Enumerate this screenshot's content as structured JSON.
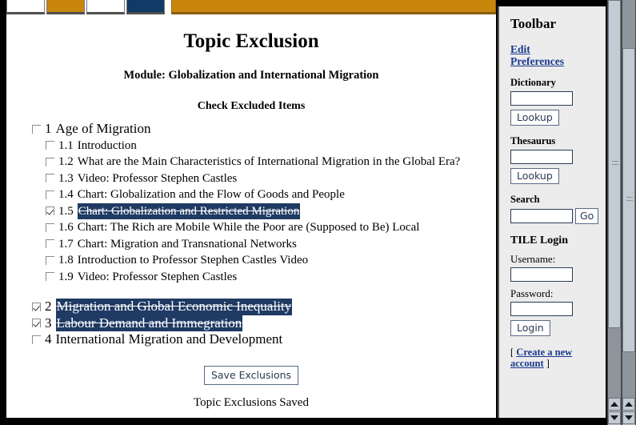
{
  "topnav": {
    "tabs": [
      {
        "name": "tab-1",
        "style": "white"
      },
      {
        "name": "tab-2",
        "style": "gold"
      },
      {
        "name": "tab-3",
        "style": "white"
      },
      {
        "name": "tab-4",
        "style": "navy"
      }
    ],
    "menu_item_count": 4
  },
  "page": {
    "title": "Topic Exclusion",
    "module_line": "Module: Globalization and International Migration",
    "section_heading": "Check Excluded Items",
    "save_button_label": "Save Exclusions",
    "status_message": "Topic Exclusions Saved"
  },
  "topics": [
    {
      "num": "1",
      "label": "Age of Migration",
      "level": 1,
      "checked": false,
      "excluded": false,
      "spaced": false
    },
    {
      "num": "1.1",
      "label": "Introduction",
      "level": 2,
      "checked": false,
      "excluded": false,
      "spaced": false
    },
    {
      "num": "1.2",
      "label": "What are the Main Characteristics of International Migration in the Global Era?",
      "level": 2,
      "checked": false,
      "excluded": false,
      "spaced": false
    },
    {
      "num": "1.3",
      "label": "Video: Professor Stephen Castles",
      "level": 2,
      "checked": false,
      "excluded": false,
      "spaced": false
    },
    {
      "num": "1.4",
      "label": "Chart: Globalization and the Flow of Goods and People",
      "level": 2,
      "checked": false,
      "excluded": false,
      "spaced": false
    },
    {
      "num": "1.5",
      "label": "Chart: Globalization and Restricted Migration",
      "level": 2,
      "checked": true,
      "excluded": true,
      "spaced": false
    },
    {
      "num": "1.6",
      "label": "Chart: The Rich are Mobile While the Poor are (Supposed to Be) Local",
      "level": 2,
      "checked": false,
      "excluded": false,
      "spaced": false
    },
    {
      "num": "1.7",
      "label": "Chart: Migration and Transnational Networks",
      "level": 2,
      "checked": false,
      "excluded": false,
      "spaced": false
    },
    {
      "num": "1.8",
      "label": "Introduction to Professor Stephen Castles Video",
      "level": 2,
      "checked": false,
      "excluded": false,
      "spaced": false
    },
    {
      "num": "1.9",
      "label": "Video: Professor Stephen Castles",
      "level": 2,
      "checked": false,
      "excluded": false,
      "spaced": false
    },
    {
      "num": "2",
      "label": "Migration and Global Economic Inequality",
      "level": 1,
      "checked": true,
      "excluded": true,
      "spaced": true
    },
    {
      "num": "3",
      "label": "Labour Demand and Immegration",
      "level": 1,
      "checked": true,
      "excluded": true,
      "spaced": false
    },
    {
      "num": "4",
      "label": "International Migration and Development",
      "level": 1,
      "checked": false,
      "excluded": false,
      "spaced": false
    }
  ],
  "toolbar": {
    "title": "Toolbar",
    "edit_preferences_link": "Edit Preferences",
    "dictionary": {
      "label": "Dictionary",
      "input_value": "",
      "button_label": "Lookup"
    },
    "thesaurus": {
      "label": "Thesaurus",
      "input_value": "",
      "button_label": "Lookup"
    },
    "search": {
      "label": "Search",
      "input_value": "",
      "button_label": "Go"
    },
    "login": {
      "title": "TILE Login",
      "username_label": "Username:",
      "username_value": "",
      "password_label": "Password:",
      "password_value": "",
      "button_label": "Login",
      "create_prefix": "[ ",
      "create_link": "Create a new account",
      "create_suffix": " ]"
    }
  },
  "colors": {
    "highlight": "#1f3a63",
    "link": "#1a3a8f",
    "gold": "#c8860d",
    "navy": "#123a66",
    "sidebar_bg": "#ececec"
  }
}
